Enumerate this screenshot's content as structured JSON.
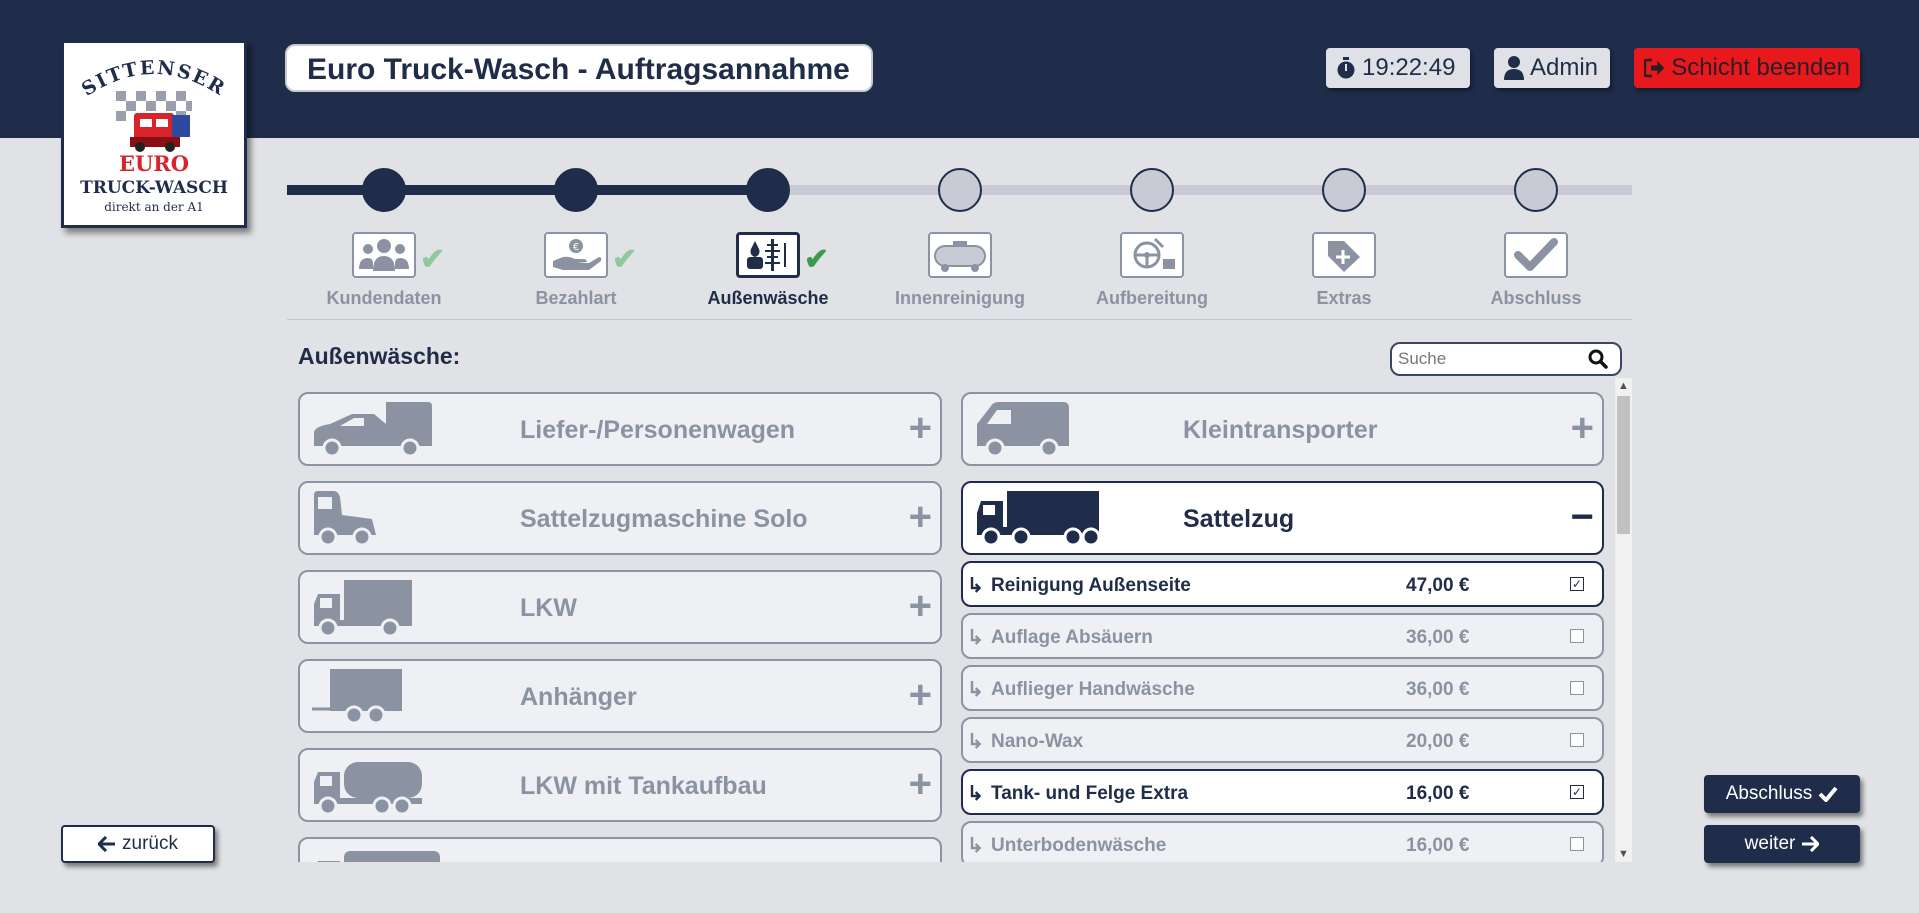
{
  "header": {
    "title": "Euro Truck-Wasch - Auftragsannahme",
    "clock": "19:22:49",
    "user": "Admin",
    "logout_label": "Schicht beenden"
  },
  "logo": {
    "line1": "SITTENSER",
    "line2": "EURO",
    "line3": "TRUCK-WASCH",
    "line4": "direkt an der A1"
  },
  "steps": [
    {
      "label": "Kundendaten",
      "state": "done",
      "icon": "customers-icon"
    },
    {
      "label": "Bezahlart",
      "state": "done",
      "icon": "payment-hand-icon"
    },
    {
      "label": "Außenwäsche",
      "state": "active",
      "icon": "exterior-wash-icon"
    },
    {
      "label": "Innenreinigung",
      "state": "pending",
      "icon": "tanker-interior-icon"
    },
    {
      "label": "Aufbereitung",
      "state": "pending",
      "icon": "detailing-icon"
    },
    {
      "label": "Extras",
      "state": "pending",
      "icon": "tag-plus-icon"
    },
    {
      "label": "Abschluss",
      "state": "pending",
      "icon": "checkmark-icon"
    }
  ],
  "section": {
    "title": "Außenwäsche:",
    "search_placeholder": "Suche"
  },
  "vehicles_left": [
    {
      "name": "Liefer-/Personenwagen",
      "icon": "van-car-icon",
      "toggle": "+"
    },
    {
      "name": "Sattelzugmaschine Solo",
      "icon": "tractor-unit-icon",
      "toggle": "+"
    },
    {
      "name": "LKW",
      "icon": "lorry-icon",
      "toggle": "+"
    },
    {
      "name": "Anhänger",
      "icon": "trailer-icon",
      "toggle": "+"
    },
    {
      "name": "LKW mit Tankaufbau",
      "icon": "tank-lorry-icon",
      "toggle": "+"
    }
  ],
  "vehicles_right": [
    {
      "name": "Kleintransporter",
      "icon": "small-van-icon",
      "toggle": "+"
    },
    {
      "name": "Sattelzug",
      "icon": "semi-truck-icon",
      "toggle": "−",
      "open": true
    }
  ],
  "services": [
    {
      "name": "Reinigung Außenseite",
      "price": "47,00 €",
      "checked": true
    },
    {
      "name": "Auflage Absäuern",
      "price": "36,00 €",
      "checked": false
    },
    {
      "name": "Auflieger Handwäsche",
      "price": "36,00 €",
      "checked": false
    },
    {
      "name": "Nano-Wax",
      "price": "20,00 €",
      "checked": false
    },
    {
      "name": "Tank- und Felge Extra",
      "price": "16,00 €",
      "checked": true
    },
    {
      "name": "Unterbodenwäsche",
      "price": "16,00 €",
      "checked": false
    }
  ],
  "nav": {
    "back_label": "zurück",
    "finish_label": "Abschluss",
    "next_label": "weiter"
  },
  "colors": {
    "primary": "#1f2d4b",
    "danger": "#e8191c",
    "check_done": "#8fc99a",
    "check_active": "#3b9a4b",
    "muted": "#8b93a3"
  }
}
